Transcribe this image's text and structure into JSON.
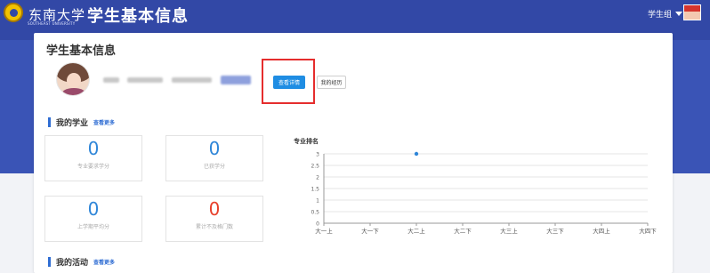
{
  "header": {
    "school_name": "东南大学",
    "school_subtitle": "SOUTHEAST UNIVERSITY",
    "app_title": "学生基本信息",
    "user_label": "学生组"
  },
  "card": {
    "title": "学生基本信息"
  },
  "profile": {
    "view_details_label": "查看详情",
    "my_resume_label": "我的经历"
  },
  "academics": {
    "title": "我的学业",
    "more": "查看更多",
    "stats": [
      {
        "value": "0",
        "label": "专业要求学分",
        "color": "#2f86d8"
      },
      {
        "value": "0",
        "label": "已获学分",
        "color": "#2f86d8"
      },
      {
        "value": "0",
        "label": "上学期平均分",
        "color": "#2f86d8"
      },
      {
        "value": "0",
        "label": "累计不及格门数",
        "color": "#e8412c"
      }
    ]
  },
  "activities": {
    "title": "我的活动",
    "more": "查看更多"
  },
  "chart_data": {
    "type": "line",
    "title": "专业排名",
    "categories": [
      "大一上",
      "大一下",
      "大二上",
      "大二下",
      "大三上",
      "大三下",
      "大四上",
      "大四下"
    ],
    "series": [
      {
        "values": [
          null,
          null,
          3,
          null,
          null,
          null,
          null,
          null
        ]
      }
    ],
    "y_ticks": [
      "0",
      "0.5",
      "1",
      "1.5",
      "2",
      "2.5",
      "3"
    ],
    "ylim": [
      0,
      3
    ],
    "grid": true,
    "point_color": "#2f86d8"
  }
}
